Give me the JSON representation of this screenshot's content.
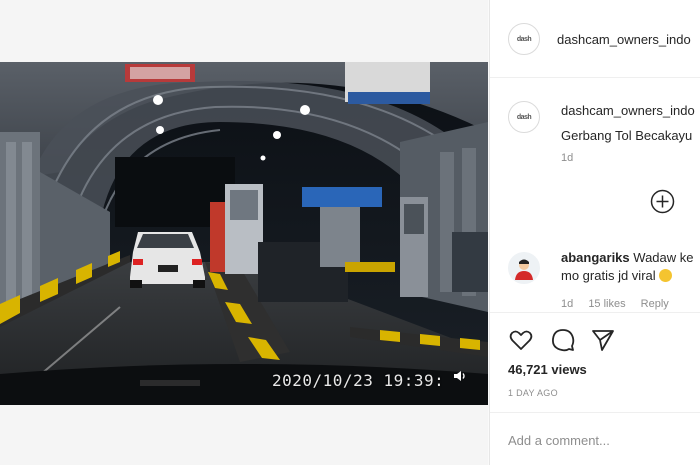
{
  "post": {
    "author": "dashcam_owners_indo",
    "caption_author": "dashcam_owners_indo",
    "caption": "Gerbang Tol Becakayu",
    "caption_time": "1d"
  },
  "video": {
    "timestamp": "2020/10/23 19:39:",
    "icon": "speaker-icon"
  },
  "comment": {
    "author": "abangariks",
    "text_line1": "Wadaw ke",
    "text_line2": "mo gratis jd viral",
    "time": "1d",
    "likes": "15 likes",
    "reply_label": "Reply"
  },
  "actions": {
    "views": "46,721 views",
    "posted": "1 DAY AGO",
    "icons": [
      "heart-icon",
      "comment-icon",
      "share-icon"
    ]
  },
  "add_comment": {
    "placeholder": "Add a comment..."
  },
  "colors": {
    "panel_bg": "#ffffff",
    "secondary_text": "#8e8e8e",
    "primary_text": "#262626"
  }
}
